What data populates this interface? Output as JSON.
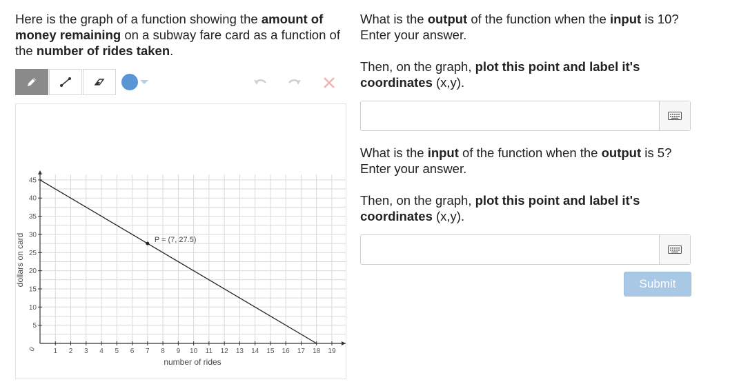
{
  "prompt": {
    "p1": "Here is the graph of a function showing the ",
    "b1": "amount of money remaining",
    "p2": " on a subway fare card as a function of the ",
    "b2": "number of rides taken",
    "p3": "."
  },
  "toolbar": {
    "tools": [
      {
        "name": "pencil-icon",
        "active": true
      },
      {
        "name": "line-icon",
        "active": false
      },
      {
        "name": "eraser-icon",
        "active": false
      }
    ],
    "color": "#5b95d6",
    "actions": [
      "undo-icon",
      "redo-icon",
      "clear-icon"
    ]
  },
  "questions": [
    {
      "q_pre": "What is the ",
      "q_b1": "output",
      "q_mid": " of the function when the ",
      "q_b2": "input",
      "q_post": " is 10? Enter your answer.",
      "t_pre": "Then, on the graph, ",
      "t_b": "plot this point and label it's coordinates",
      "t_post": " (x,y).",
      "value": ""
    },
    {
      "q_pre": "What is the ",
      "q_b1": "input",
      "q_mid": " of the function when the ",
      "q_b2": "output",
      "q_post": " is 5? Enter your answer.",
      "t_pre": "Then, on the graph, ",
      "t_b": "plot this point and label it's coordinates",
      "t_post": " (x,y).",
      "value": ""
    }
  ],
  "submit_label": "Submit",
  "chart_data": {
    "type": "line",
    "xlabel": "number of rides",
    "ylabel": "dollars on card",
    "x_ticks": [
      "1",
      "2",
      "3",
      "4",
      "5",
      "6",
      "7",
      "8",
      "9",
      "10",
      "11",
      "12",
      "13",
      "14",
      "15",
      "16",
      "17",
      "18",
      "19"
    ],
    "y_ticks": [
      "5",
      "10",
      "15",
      "20",
      "25",
      "30",
      "35",
      "40",
      "45"
    ],
    "origin_label": "0",
    "xlim": [
      0,
      19
    ],
    "ylim": [
      0,
      45
    ],
    "series": [
      {
        "x": [
          0,
          18
        ],
        "y": [
          45,
          0
        ]
      }
    ],
    "point": {
      "x": 7,
      "y": 27.5,
      "label": "P = (7, 27.5)"
    },
    "grid": true
  }
}
